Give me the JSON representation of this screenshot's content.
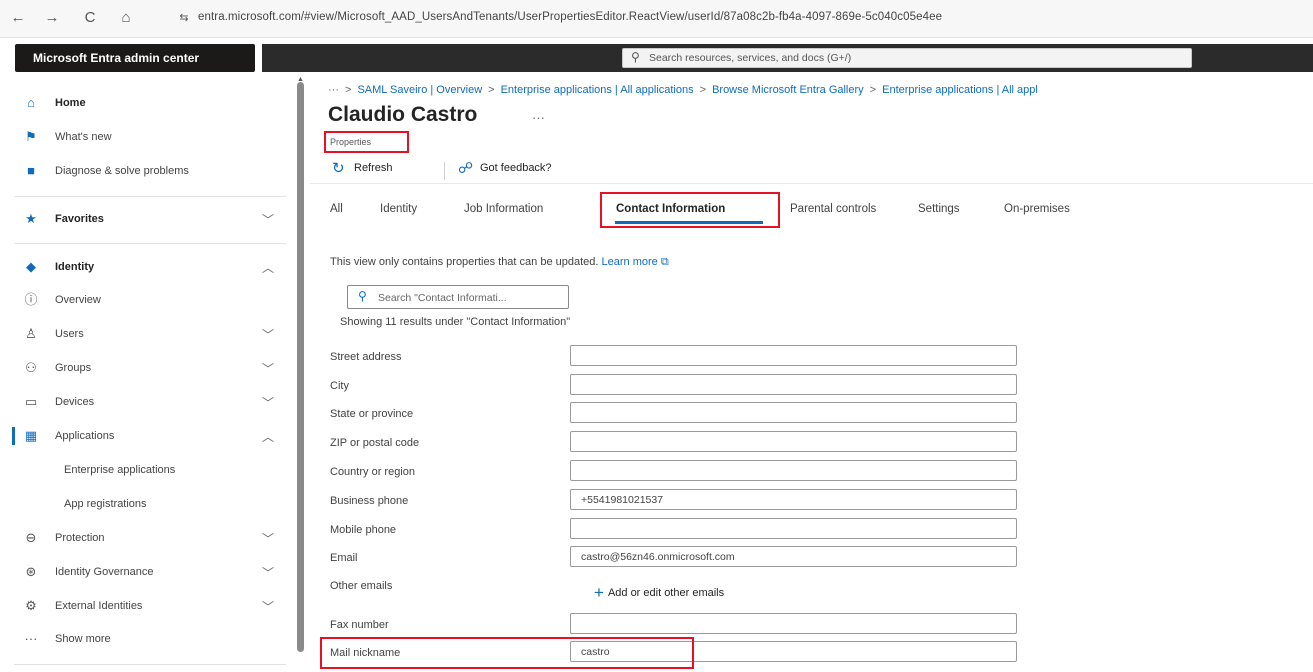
{
  "browser": {
    "back": "←",
    "forward": "→",
    "reload": "C",
    "home": "⌂",
    "site_icon": "⇆",
    "url": "entra.microsoft.com/#view/Microsoft_AAD_UsersAndTenants/UserPropertiesEditor.ReactView/userId/87a08c2b-fb4a-4097-869e-5c040c05e4ee"
  },
  "header": {
    "brand": "Microsoft Entra admin center",
    "search_placeholder": "Search resources, services, and docs (G+/)"
  },
  "sidebar": {
    "home": "Home",
    "whats_new": "What's new",
    "diagnose": "Diagnose & solve problems",
    "favorites": "Favorites",
    "identity": "Identity",
    "overview": "Overview",
    "users": "Users",
    "groups": "Groups",
    "devices": "Devices",
    "applications": "Applications",
    "enterprise_apps": "Enterprise applications",
    "app_registrations": "App registrations",
    "protection": "Protection",
    "identity_governance": "Identity Governance",
    "external_identities": "External Identities",
    "show_more": "Show more"
  },
  "breadcrumb": {
    "ellipsis": "···",
    "items": [
      "SAML Saveiro | Overview",
      "Enterprise applications | All applications",
      "Browse Microsoft Entra Gallery",
      "Enterprise applications | All appl"
    ]
  },
  "page": {
    "title": "Claudio Castro",
    "more": "···",
    "subtitle": "Properties"
  },
  "commands": {
    "refresh": "Refresh",
    "feedback": "Got feedback?"
  },
  "tabs": [
    "All",
    "Identity",
    "Job Information",
    "Contact Information",
    "Parental controls",
    "Settings",
    "On-premises"
  ],
  "info": {
    "text": "This view only contains properties that can be updated.",
    "link": "Learn more",
    "link_icon": "⧉"
  },
  "filter": {
    "placeholder": "Search \"Contact Informati..."
  },
  "result_count": "Showing 11 results under \"Contact Information\"",
  "fields": {
    "street": {
      "label": "Street address",
      "value": ""
    },
    "city": {
      "label": "City",
      "value": ""
    },
    "state": {
      "label": "State or province",
      "value": ""
    },
    "zip": {
      "label": "ZIP or postal code",
      "value": ""
    },
    "country": {
      "label": "Country or region",
      "value": ""
    },
    "business_phone": {
      "label": "Business phone",
      "value": "+5541981021537"
    },
    "mobile_phone": {
      "label": "Mobile phone",
      "value": ""
    },
    "email": {
      "label": "Email",
      "value": "castro@56zn46.onmicrosoft.com"
    },
    "other_emails": {
      "label": "Other emails",
      "action": "Add or edit other emails"
    },
    "fax": {
      "label": "Fax number",
      "value": ""
    },
    "mail_nickname": {
      "label": "Mail nickname",
      "value": "castro"
    }
  },
  "colors": {
    "accent": "#0f6cbd",
    "highlight": "#e81123",
    "brand_bar": "#1b1a19"
  }
}
